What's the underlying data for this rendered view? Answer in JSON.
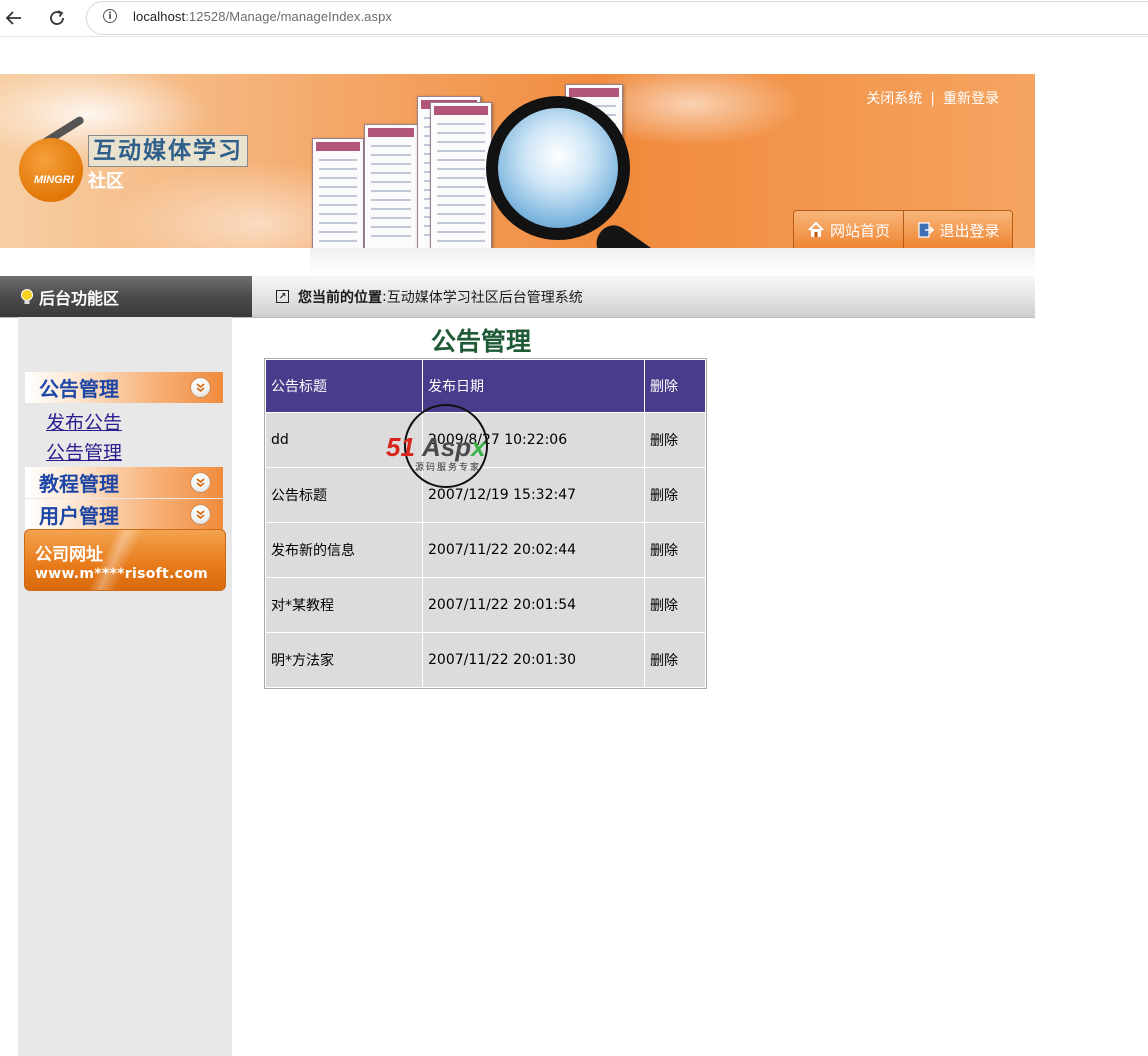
{
  "browser": {
    "url_host": "localhost",
    "url_rest": ":12528/Manage/manageIndex.aspx"
  },
  "banner": {
    "logo_text": "MINGRI",
    "site_title": "互动媒体学习",
    "site_subtitle": "社区",
    "top_links": {
      "close_system": "关闭系统",
      "separator": "|",
      "relogin": "重新登录"
    },
    "buttons": {
      "home": "网站首页",
      "logout": "退出登录"
    }
  },
  "navstrip": {
    "left_label": "后台功能区",
    "location_label": "您当前的位置",
    "location_sep": ":",
    "location_value": "互动媒体学习社区后台管理系统"
  },
  "sidebar": {
    "notice_group": "公告管理",
    "notice_items": [
      "发布公告",
      "公告管理"
    ],
    "tutorial_group": "教程管理",
    "user_group": "用户管理",
    "company": {
      "title": "公司网址",
      "url": "www.m****risoft.com"
    }
  },
  "main": {
    "page_title": "公告管理",
    "table": {
      "headers": [
        "公告标题",
        "发布日期",
        "删除"
      ],
      "rows": [
        {
          "title": "dd",
          "date": "2009/8/27 10:22:06",
          "action": "删除"
        },
        {
          "title": "公告标题",
          "date": "2007/12/19 15:32:47",
          "action": "删除"
        },
        {
          "title": "发布新的信息",
          "date": "2007/11/22 20:02:44",
          "action": "删除"
        },
        {
          "title": "对*某教程",
          "date": "2007/11/22 20:01:54",
          "action": "删除"
        },
        {
          "title": "明*方法家",
          "date": "2007/11/22 20:01:30",
          "action": "删除"
        }
      ]
    }
  },
  "watermark": {
    "brand_red": "51",
    "brand_gray": "Asp",
    "brand_green": "x",
    "tagline": "源码服务专家"
  },
  "colors": {
    "table_header": "#4a3c8c",
    "menu_text": "#1d46a6",
    "title_green": "#1f5a36",
    "banner_orange": "#f08a3c"
  }
}
